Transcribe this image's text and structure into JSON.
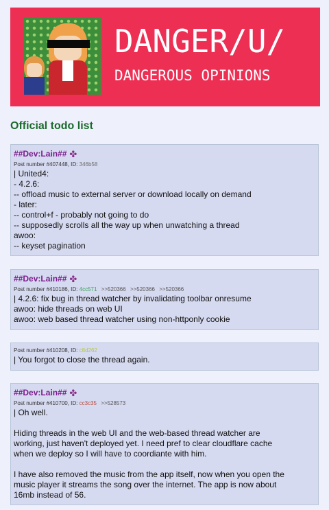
{
  "banner": {
    "title": "DANGER/U/",
    "subtitle": "DANGEROUS OPINIONS"
  },
  "page_title": "Official todo list",
  "posts": [
    {
      "name": "##Dev:Lain##",
      "post_number": "Post number #407448, ID: ",
      "id": "346b58",
      "id_color": "#6b6b6b",
      "quotes": [],
      "lines": [
        "| United4:",
        "- 4.2.6:",
        "-- offload music to external server or download locally on demand",
        "- later:",
        "-- control+f - probably not going to do",
        "-- supposedly scrolls all the way up when unwatching a thread",
        "awoo:",
        "-- keyset pagination"
      ]
    },
    {
      "name": "##Dev:Lain##",
      "post_number": "Post number #410186, ID: ",
      "id": "4cc571",
      "id_color": "#3aa15a",
      "quotes": [
        ">>520366",
        ">>520366",
        ">>520366"
      ],
      "lines": [
        "| 4.2.6: fix bug in thread watcher by invalidating toolbar onresume",
        "awoo: hide threads on web UI",
        "awoo: web based thread watcher using non-httponly cookie"
      ]
    },
    {
      "name": "",
      "post_number": "Post number #410208, ID: ",
      "id": "c8d262",
      "id_color": "#b5c642",
      "quotes": [],
      "lines": [
        "| You forgot to close the thread again."
      ]
    },
    {
      "name": "##Dev:Lain##",
      "post_number": "Post number #410700, ID: ",
      "id": "cc3c35",
      "id_color": "#b84a3e",
      "quotes": [
        ">>528573"
      ],
      "lines": [
        "| Oh well.",
        "",
        "Hiding threads in the web UI and the web-based thread watcher are",
        "working, just haven't deployed yet. I need pref to clear cloudflare cache",
        "when we deploy so I will have to coordiante with him.",
        "",
        "I have also removed the music from the app itself, now when you open the",
        "music player it streams the song over the internet. The app is now about",
        "16mb instead of 56."
      ]
    }
  ],
  "icons": {
    "tripcode_badge": "clover-icon"
  }
}
